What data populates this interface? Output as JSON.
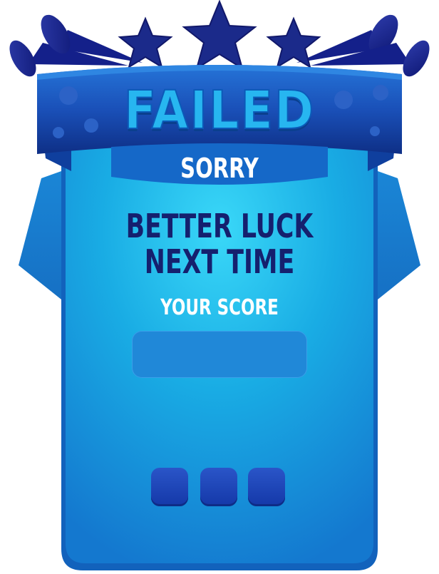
{
  "panel": {
    "title": "FAILED",
    "subtitle": "SORRY",
    "message_line1": "BETTER LUCK",
    "message_line2": "NEXT TIME",
    "score_label": "YOUR SCORE",
    "score_value": ""
  },
  "stars": {
    "count": 3
  },
  "buttons": [
    {
      "icon": "blank-button"
    },
    {
      "icon": "blank-button"
    },
    {
      "icon": "blank-button"
    }
  ],
  "colors": {
    "panel_light": "#2fd0f6",
    "panel_mid": "#17a8e2",
    "panel_dark": "#1272c8",
    "ribbon_blue": "#1a4fb6",
    "navy_text": "#15206e",
    "horn_navy": "#14208a",
    "score_box": "#2088d8",
    "button_blue": "#1e46b8"
  }
}
